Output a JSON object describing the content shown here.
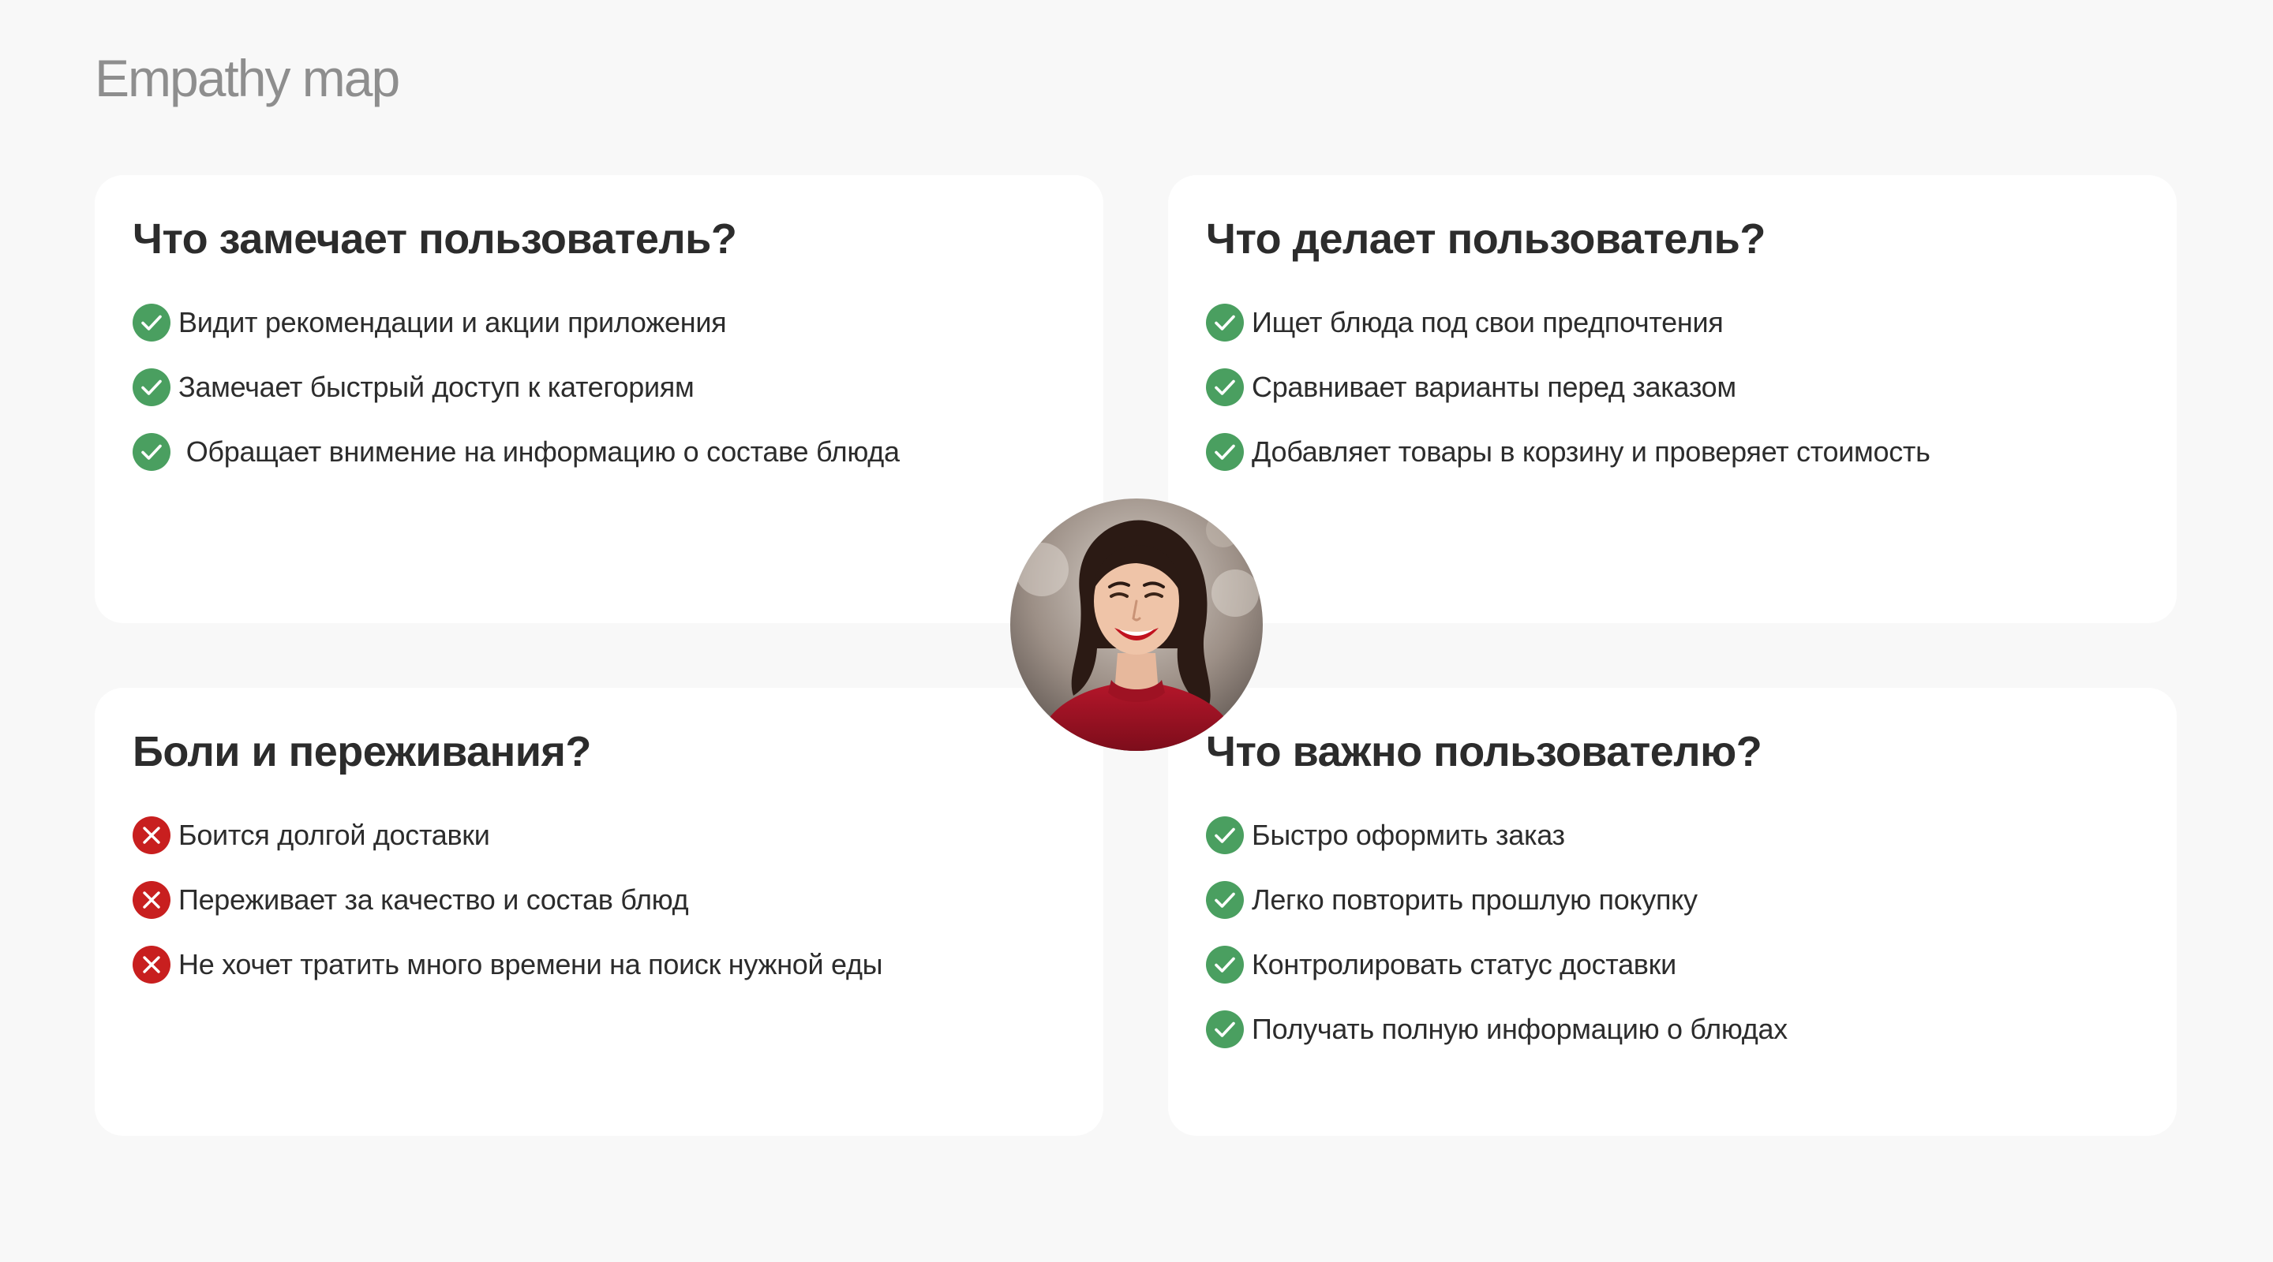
{
  "page": {
    "title": "Empathy map"
  },
  "colors": {
    "positive": "#4a9f60",
    "negative": "#c81f1f",
    "background": "#f8f8f8",
    "card": "#ffffff"
  },
  "quadrants": [
    {
      "title": "Что замечает пользователь?",
      "icon": "check-circle-icon",
      "items": [
        "Видит рекомендации и акции приложения",
        "Замечает быстрый доступ к категориям",
        " Обращает внимение на информацию о составе блюда"
      ]
    },
    {
      "title": "Что делает пользователь?",
      "icon": "check-circle-icon",
      "items": [
        "Ищет блюда под свои предпочтения",
        "Сравнивает варианты перед заказом",
        "Добавляет товары в корзину и проверяет стоимость"
      ]
    },
    {
      "title": "Боли и переживания?",
      "icon": "cross-circle-icon",
      "items": [
        "Боится долгой доставки",
        "Переживает за качество и состав блюд",
        "Не хочет тратить много времени на поиск нужной еды"
      ]
    },
    {
      "title": "Что важно пользователю?",
      "icon": "check-circle-icon",
      "items": [
        "Быстро оформить заказ",
        "Легко повторить прошлую покупку",
        "Контролировать статус доставки",
        "Получать полную информацию о блюдах"
      ]
    }
  ]
}
